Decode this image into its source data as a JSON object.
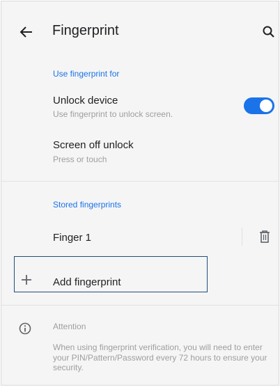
{
  "header": {
    "title": "Fingerprint",
    "back_icon": "arrow-back-icon",
    "search_icon": "search-icon"
  },
  "use_section": {
    "header": "Use fingerprint for",
    "unlock": {
      "title": "Unlock device",
      "subtitle": "Use fingerprint to unlock screen.",
      "toggle_on": true
    },
    "screen_off": {
      "title": "Screen off unlock",
      "subtitle": "Press or touch"
    }
  },
  "stored_section": {
    "header": "Stored fingerprints",
    "fingers": [
      {
        "label": "Finger 1",
        "icon": "trash-icon"
      }
    ],
    "add_label": "Add fingerprint",
    "add_icon": "plus-icon"
  },
  "attention": {
    "icon": "info-icon",
    "title": "Attention",
    "text": "When using fingerprint verification, you will need to enter your PIN/Pattern/Password every 72 hours to ensure your security."
  },
  "colors": {
    "accent": "#1a73e8",
    "background": "#f5f5f5",
    "text_primary": "#202124",
    "text_secondary": "#9e9e9e"
  }
}
